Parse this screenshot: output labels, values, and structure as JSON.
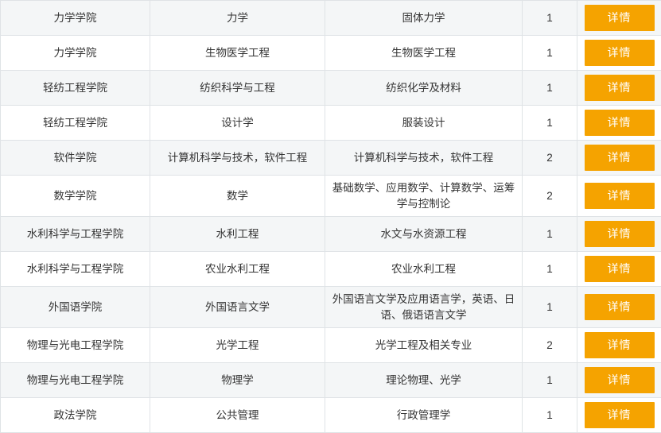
{
  "table": {
    "button_label": "详情",
    "rows": [
      {
        "college": "力学学院",
        "discipline": "力学",
        "major": "固体力学",
        "count": "1",
        "action": "详情"
      },
      {
        "college": "力学学院",
        "discipline": "生物医学工程",
        "major": "生物医学工程",
        "count": "1",
        "action": "详情"
      },
      {
        "college": "轻纺工程学院",
        "discipline": "纺织科学与工程",
        "major": "纺织化学及材料",
        "count": "1",
        "action": "详情"
      },
      {
        "college": "轻纺工程学院",
        "discipline": "设计学",
        "major": "服装设计",
        "count": "1",
        "action": "详情"
      },
      {
        "college": "软件学院",
        "discipline": "计算机科学与技术，软件工程",
        "major": "计算机科学与技术，软件工程",
        "count": "2",
        "action": "详情"
      },
      {
        "college": "数学学院",
        "discipline": "数学",
        "major": "基础数学、应用数学、计算数学、运筹学与控制论",
        "count": "2",
        "action": "详情"
      },
      {
        "college": "水利科学与工程学院",
        "discipline": "水利工程",
        "major": "水文与水资源工程",
        "count": "1",
        "action": "详情"
      },
      {
        "college": "水利科学与工程学院",
        "discipline": "农业水利工程",
        "major": "农业水利工程",
        "count": "1",
        "action": "详情"
      },
      {
        "college": "外国语学院",
        "discipline": "外国语言文学",
        "major": "外国语言文学及应用语言学，英语、日语、俄语语言文学",
        "count": "1",
        "action": "详情"
      },
      {
        "college": "物理与光电工程学院",
        "discipline": "光学工程",
        "major": "光学工程及相关专业",
        "count": "2",
        "action": "详情"
      },
      {
        "college": "物理与光电工程学院",
        "discipline": "物理学",
        "major": "理论物理、光学",
        "count": "1",
        "action": "详情"
      },
      {
        "college": "政法学院",
        "discipline": "公共管理",
        "major": "行政管理学",
        "count": "1",
        "action": "详情"
      }
    ]
  }
}
